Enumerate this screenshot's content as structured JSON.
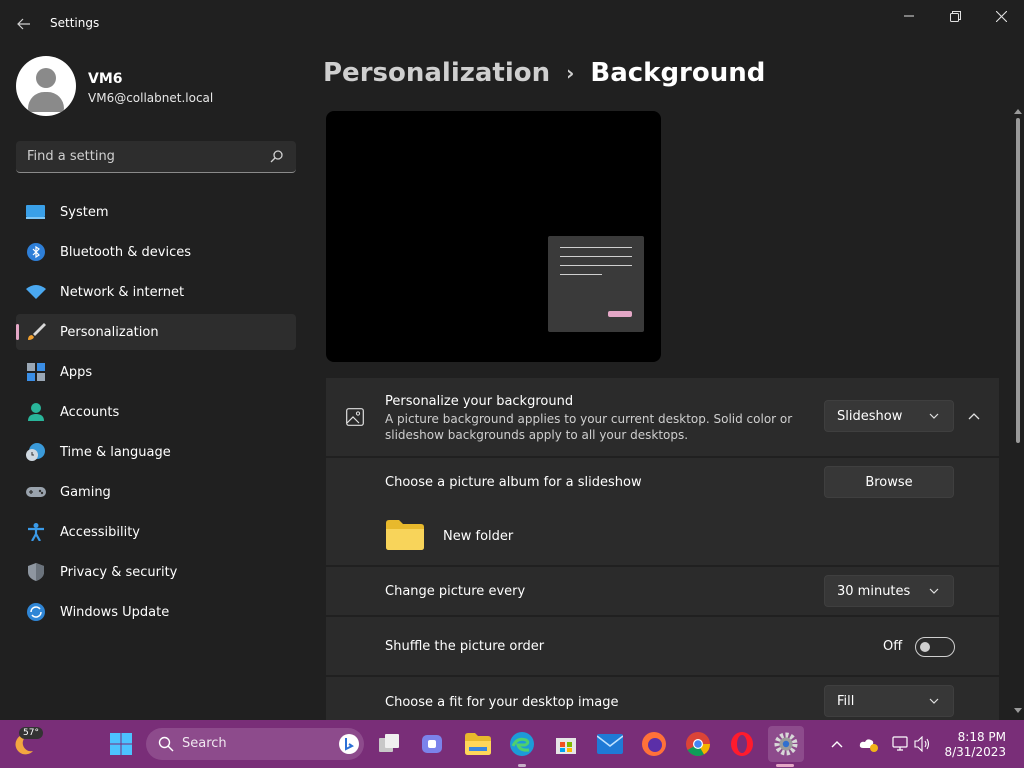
{
  "window": {
    "title": "Settings",
    "back_icon": "arrow-left-icon",
    "minimize_icon": "minimize-icon",
    "maximize_icon": "restore-icon",
    "close_icon": "close-icon"
  },
  "user": {
    "name": "VM6",
    "email": "VM6@collabnet.local"
  },
  "search": {
    "placeholder": "Find a setting",
    "icon": "search-icon"
  },
  "sidebar": {
    "items": [
      {
        "label": "System",
        "icon": "monitor-icon",
        "active": false
      },
      {
        "label": "Bluetooth & devices",
        "icon": "bluetooth-icon",
        "active": false
      },
      {
        "label": "Network & internet",
        "icon": "wifi-icon",
        "active": false
      },
      {
        "label": "Personalization",
        "icon": "brush-icon",
        "active": true
      },
      {
        "label": "Apps",
        "icon": "apps-icon",
        "active": false
      },
      {
        "label": "Accounts",
        "icon": "person-icon",
        "active": false
      },
      {
        "label": "Time & language",
        "icon": "globe-clock-icon",
        "active": false
      },
      {
        "label": "Gaming",
        "icon": "gamepad-icon",
        "active": false
      },
      {
        "label": "Accessibility",
        "icon": "accessibility-icon",
        "active": false
      },
      {
        "label": "Privacy & security",
        "icon": "shield-icon",
        "active": false
      },
      {
        "label": "Windows Update",
        "icon": "sync-icon",
        "active": false
      }
    ]
  },
  "breadcrumb": {
    "parent": "Personalization",
    "separator": "›",
    "current": "Background"
  },
  "background_section": {
    "title": "Personalize your background",
    "description_line1": "A picture background applies to your current desktop. Solid color or",
    "description_line2": "slideshow backgrounds apply to all your desktops.",
    "type_value": "Slideshow",
    "album_label": "Choose a picture album for a slideshow",
    "browse_label": "Browse",
    "folder_name": "New folder",
    "interval_label": "Change picture every",
    "interval_value": "30 minutes",
    "shuffle_label": "Shuffle the picture order",
    "shuffle_state": "Off",
    "fit_label": "Choose a fit for your desktop image",
    "fit_value": "Fill"
  },
  "taskbar": {
    "weather_temp": "57°",
    "search_label": "Search",
    "time": "8:18 PM",
    "date": "8/31/2023"
  },
  "colors": {
    "accent": "#e4a7c6",
    "taskbar": "#792e78",
    "background": "#202020",
    "card": "#2b2b2b"
  }
}
